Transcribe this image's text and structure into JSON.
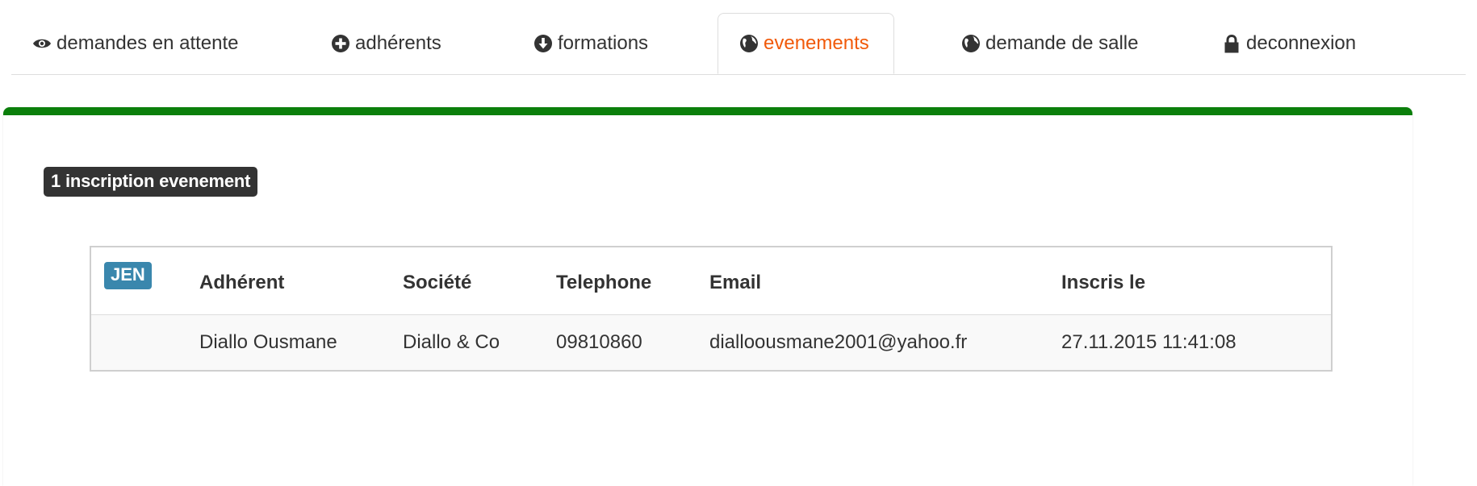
{
  "nav": {
    "tabs": [
      {
        "label": "demandes en attente",
        "icon": "eye-icon",
        "active": false
      },
      {
        "label": "adhérents",
        "icon": "plus-circle-icon",
        "active": false
      },
      {
        "label": "formations",
        "icon": "arrow-down-circle-icon",
        "active": false
      },
      {
        "label": "evenements",
        "icon": "globe-icon",
        "active": true
      },
      {
        "label": "demande de salle",
        "icon": "globe-icon",
        "active": false
      },
      {
        "label": "deconnexion",
        "icon": "lock-icon",
        "active": false
      }
    ]
  },
  "colors": {
    "active_tab": "#f15a0a",
    "panel_top_border": "#0b7f0b",
    "count_label_bg": "#333333",
    "month_badge_bg": "#3a87ad"
  },
  "panel": {
    "count_label": "1 inscription evenement",
    "month_badge": "JEN",
    "table": {
      "headers": [
        "Adhérent",
        "Société",
        "Telephone",
        "Email",
        "Inscris le"
      ],
      "rows": [
        [
          "Diallo Ousmane",
          "Diallo & Co",
          "09810860",
          "dialloousmane2001@yahoo.fr",
          "27.11.2015 11:41:08"
        ]
      ]
    }
  }
}
